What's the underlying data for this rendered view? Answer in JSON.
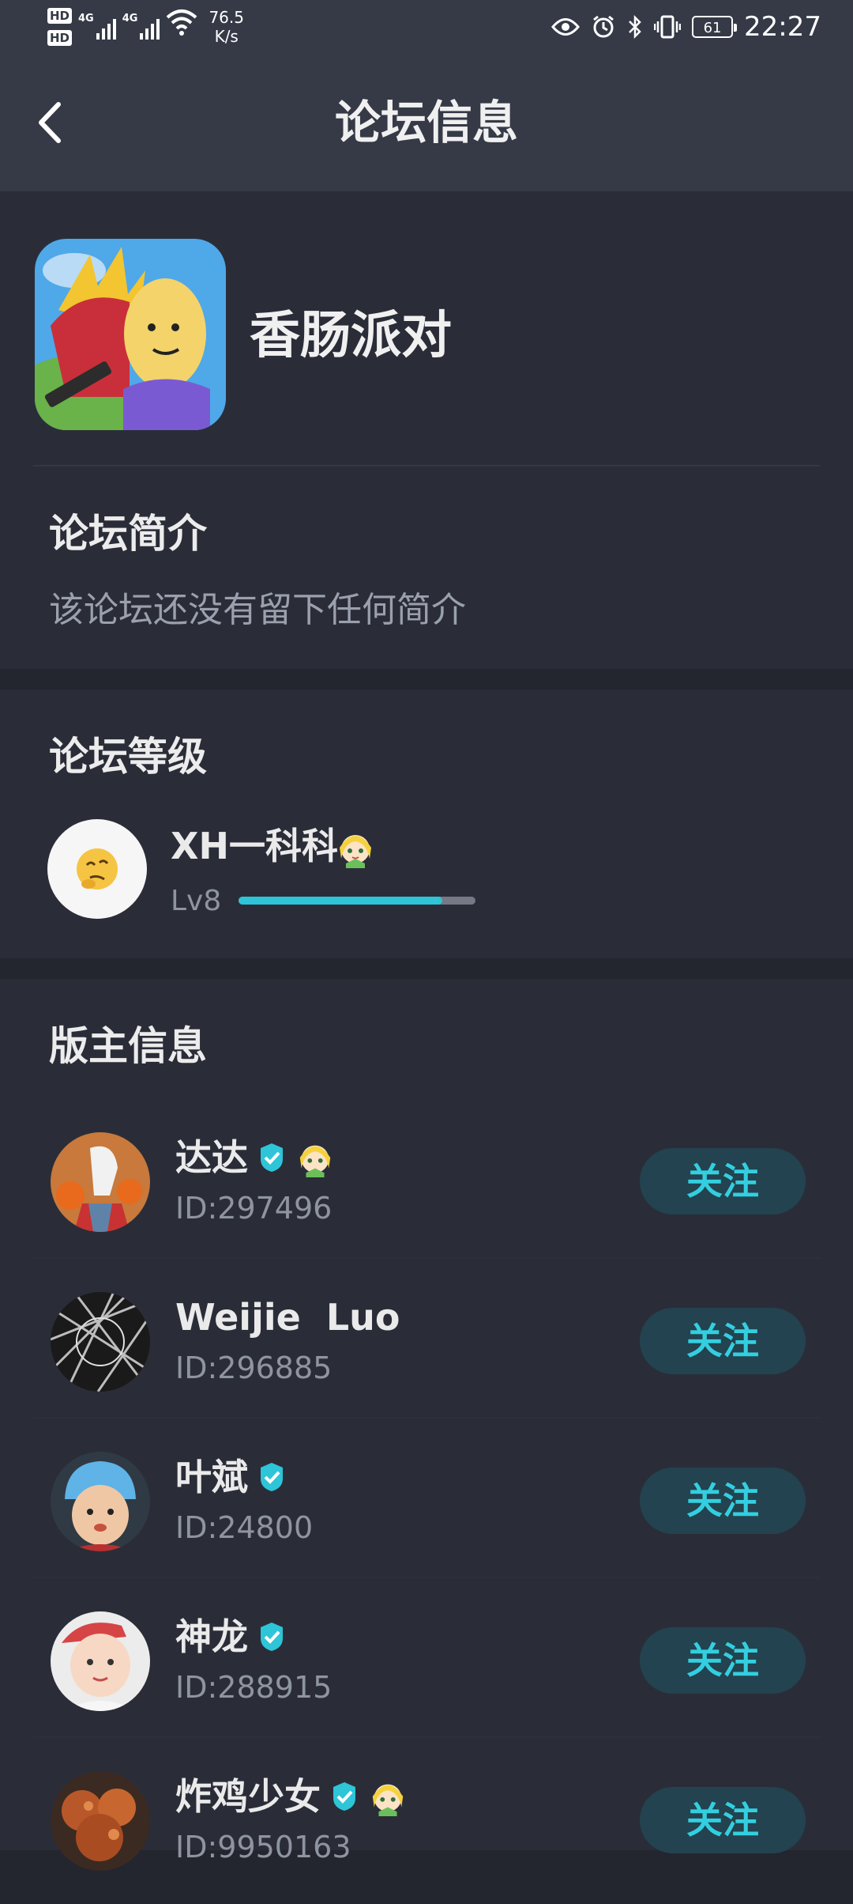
{
  "status_bar": {
    "hd1": "HD",
    "hd2": "HD",
    "sim1_label": "4G",
    "sim2_label": "4G",
    "net_speed_value": "76.5",
    "net_speed_unit": "K/s",
    "battery": "61",
    "time": "22:27"
  },
  "header": {
    "title": "论坛信息"
  },
  "forum": {
    "name": "香肠派对"
  },
  "intro": {
    "title": "论坛简介",
    "text": "该论坛还没有留下任何简介"
  },
  "level": {
    "title": "论坛等级",
    "user_name": "XH一科科",
    "level_label": "Lv8",
    "progress_fraction": 0.86
  },
  "moderators": {
    "title": "版主信息",
    "follow_label": "关注",
    "items": [
      {
        "name": "达达",
        "id_text": "ID:297496",
        "verified": true,
        "badge": true
      },
      {
        "name": "Weijie  Luo",
        "id_text": "ID:296885",
        "verified": false,
        "badge": false
      },
      {
        "name": "叶斌",
        "id_text": "ID:24800",
        "verified": true,
        "badge": false
      },
      {
        "name": "神龙",
        "id_text": "ID:288915",
        "verified": true,
        "badge": false
      },
      {
        "name": "炸鸡少女",
        "id_text": "ID:9950163",
        "verified": true,
        "badge": true
      }
    ]
  },
  "colors": {
    "accent": "#2dc5d7",
    "header_bg": "#363a47",
    "page_bg": "#23252f",
    "card_bg": "#2a2d38"
  }
}
